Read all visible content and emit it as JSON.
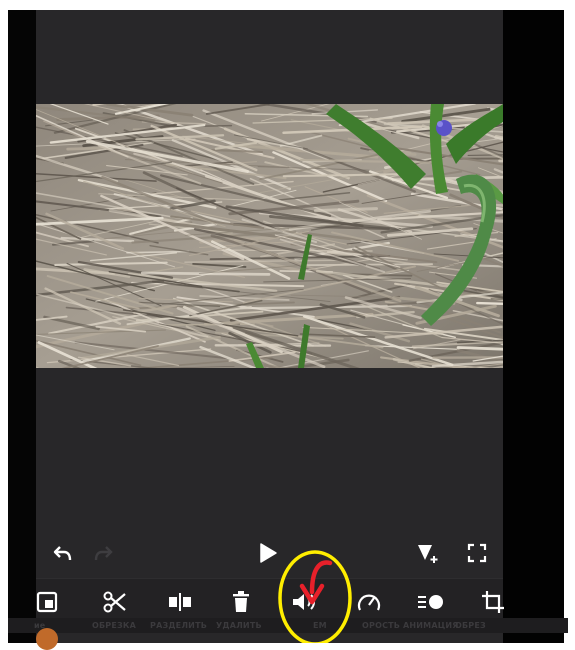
{
  "toolbar": {
    "labels": [
      "ОБРЕЗКА",
      "РАЗДЕЛИТЬ",
      "УДАЛИТЬ",
      "ЕМ",
      "ОРОСТЬ",
      "АНИМАЦИЯ",
      "ОБРЕЗ"
    ],
    "left_label": "ие"
  },
  "icons": {
    "undo": "undo-icon",
    "redo": "redo-icon",
    "play": "play-icon",
    "keyframe": "add-keyframe-icon",
    "fullscreen": "fullscreen-icon",
    "pip": "picture-in-picture-icon",
    "scissors": "scissors-icon",
    "split": "split-icon",
    "delete": "trash-icon",
    "volume": "volume-icon",
    "speed": "speed-gauge-icon",
    "animation": "animation-icon",
    "crop": "crop-icon"
  },
  "colors": {
    "app_bg": "#282729",
    "toolbar_bg": "#232224",
    "annotation_circle": "#ffee00",
    "annotation_arrow": "#e8202a"
  }
}
